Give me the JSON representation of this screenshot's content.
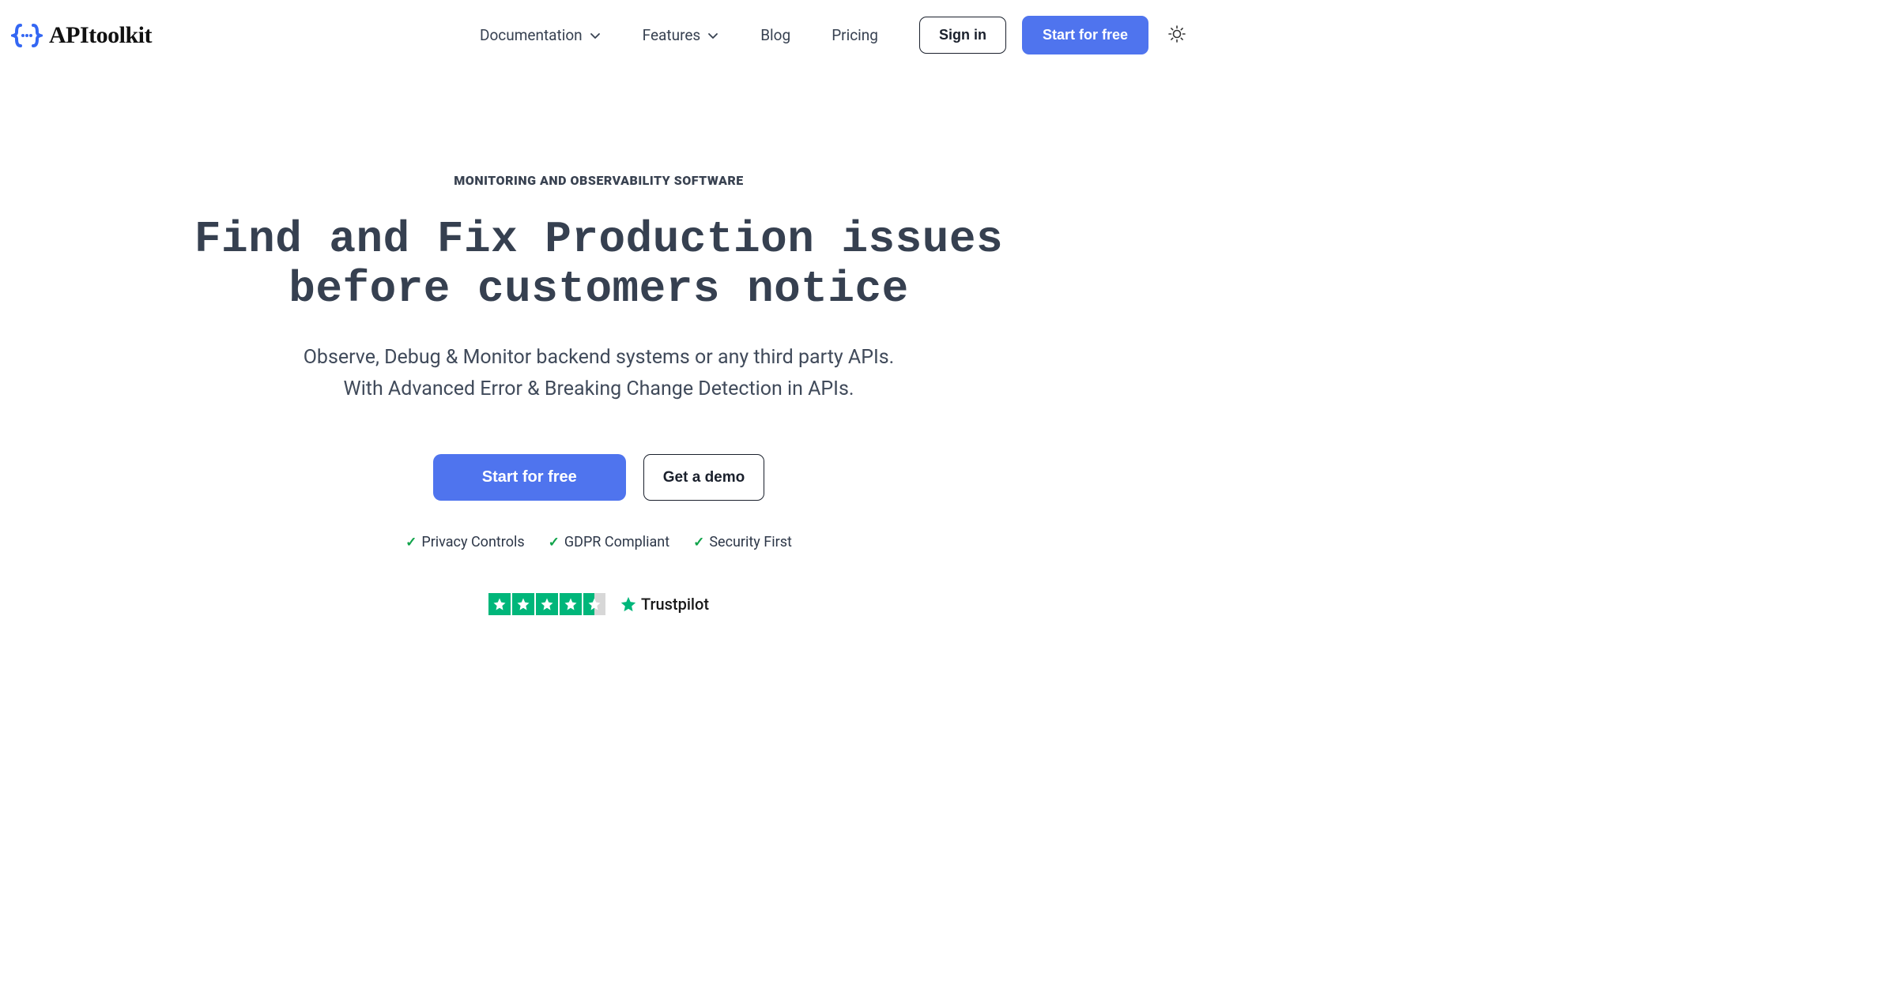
{
  "brand": {
    "name": "APItoolkit"
  },
  "nav": {
    "documentation": "Documentation",
    "features": "Features",
    "blog": "Blog",
    "pricing": "Pricing"
  },
  "actions": {
    "sign_in": "Sign in",
    "start_for_free": "Start for free"
  },
  "hero": {
    "eyebrow": "MONITORING AND OBSERVABILITY SOFTWARE",
    "headline_line1": "Find and Fix Production issues",
    "headline_line2": "before customers notice",
    "sub_line1": "Observe, Debug & Monitor backend systems or any third party APIs.",
    "sub_line2": "With Advanced Error & Breaking Change Detection in APIs."
  },
  "cta": {
    "primary": "Start for free",
    "secondary": "Get a demo"
  },
  "badges": {
    "privacy": "Privacy Controls",
    "gdpr": "GDPR Compliant",
    "security": "Security First"
  },
  "trustpilot": {
    "brand": "Trustpilot"
  }
}
